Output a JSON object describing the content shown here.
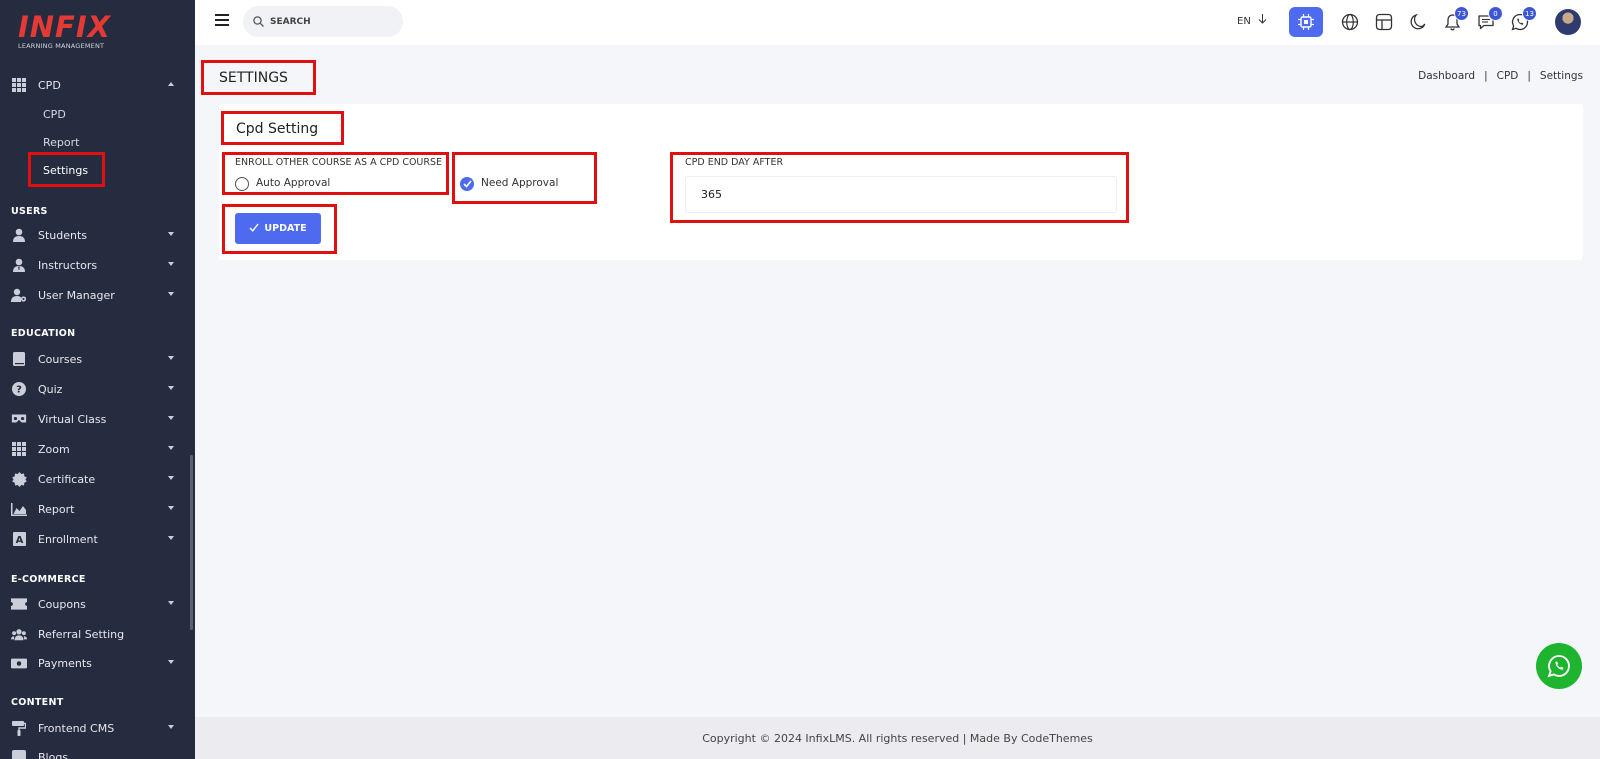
{
  "brand": {
    "name": "INFIX",
    "tagline": "LEARNING MANAGEMENT"
  },
  "sidebar": {
    "cpd_group": {
      "label": "CPD",
      "subitems": [
        "CPD",
        "Report",
        "Settings"
      ]
    },
    "sections": [
      {
        "title": "USERS",
        "items": [
          "Students",
          "Instructors",
          "User Manager"
        ]
      },
      {
        "title": "EDUCATION",
        "items": [
          "Courses",
          "Quiz",
          "Virtual Class",
          "Zoom",
          "Certificate",
          "Report",
          "Enrollment"
        ]
      },
      {
        "title": "E-COMMERCE",
        "items": [
          "Coupons",
          "Referral Setting",
          "Payments"
        ]
      },
      {
        "title": "CONTENT",
        "items": [
          "Frontend CMS",
          "Blogs"
        ]
      }
    ]
  },
  "topbar": {
    "search_placeholder": "SEARCH",
    "language": "EN",
    "notifications_count": "73",
    "messages_count": "0",
    "whatsapp_count": "13"
  },
  "page": {
    "title": "SETTINGS",
    "breadcrumb": [
      "Dashboard",
      "CPD",
      "Settings"
    ]
  },
  "cpd_setting": {
    "card_title": "Cpd Setting",
    "enroll_label": "ENROLL OTHER COURSE AS A CPD COURSE",
    "option_auto": "Auto Approval",
    "option_need": "Need Approval",
    "selected": "Need Approval",
    "end_day_label": "CPD END DAY AFTER",
    "end_day_value": "365",
    "update_label": "UPDATE"
  },
  "footer": {
    "text": "Copyright © 2024 InfixLMS. All rights reserved | Made By CodeThemes"
  },
  "colors": {
    "sidebar_bg": "#262c3f",
    "accent": "#4e6bef",
    "highlight": "#e01010",
    "brand_red": "#e53935",
    "whatsapp": "#1fb42f"
  }
}
